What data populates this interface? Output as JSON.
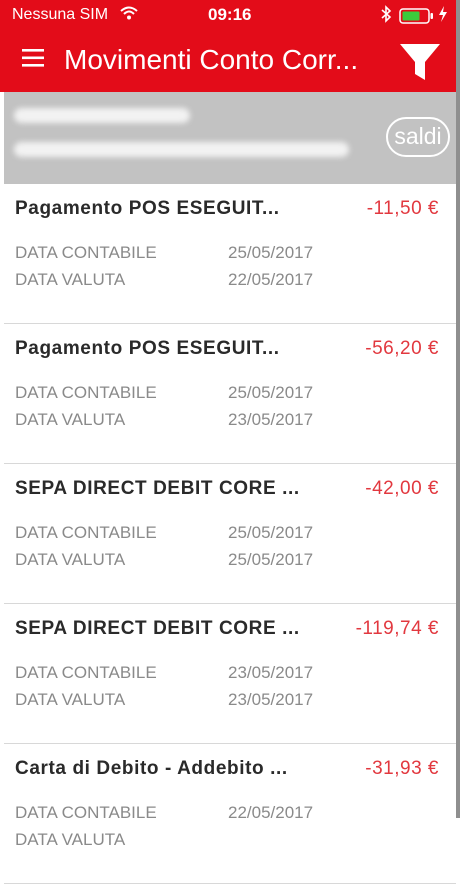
{
  "status_bar": {
    "carrier": "Nessuna SIM",
    "time": "09:16"
  },
  "header": {
    "title": "Movimenti Conto Corr...",
    "menu_icon": "hamburger-menu-icon",
    "filter_icon": "funnel-filter-icon"
  },
  "account": {
    "saldi_label": "saldi"
  },
  "transactions": [
    {
      "description": "Pagamento POS ESEGUIT...",
      "amount": "-11,50 €",
      "label_contabile": "DATA CONTABILE",
      "data_contabile": "25/05/2017",
      "label_valuta": "DATA VALUTA",
      "data_valuta": "22/05/2017"
    },
    {
      "description": "Pagamento POS ESEGUIT...",
      "amount": "-56,20 €",
      "label_contabile": "DATA CONTABILE",
      "data_contabile": "25/05/2017",
      "label_valuta": "DATA VALUTA",
      "data_valuta": "23/05/2017"
    },
    {
      "description": "SEPA DIRECT DEBIT CORE ...",
      "amount": "-42,00 €",
      "label_contabile": "DATA CONTABILE",
      "data_contabile": "25/05/2017",
      "label_valuta": "DATA VALUTA",
      "data_valuta": "25/05/2017"
    },
    {
      "description": "SEPA DIRECT DEBIT CORE ...",
      "amount": "-119,74 €",
      "label_contabile": "DATA CONTABILE",
      "data_contabile": "23/05/2017",
      "label_valuta": "DATA VALUTA",
      "data_valuta": "23/05/2017"
    },
    {
      "description": "Carta di Debito - Addebito ...",
      "amount": "-31,93 €",
      "label_contabile": "DATA CONTABILE",
      "data_contabile": "22/05/2017",
      "label_valuta": "DATA VALUTA",
      "data_valuta": ""
    }
  ],
  "colors": {
    "brand_red": "#e30c19",
    "amount_red": "#e2383f",
    "account_gray": "#c2c2c2"
  }
}
